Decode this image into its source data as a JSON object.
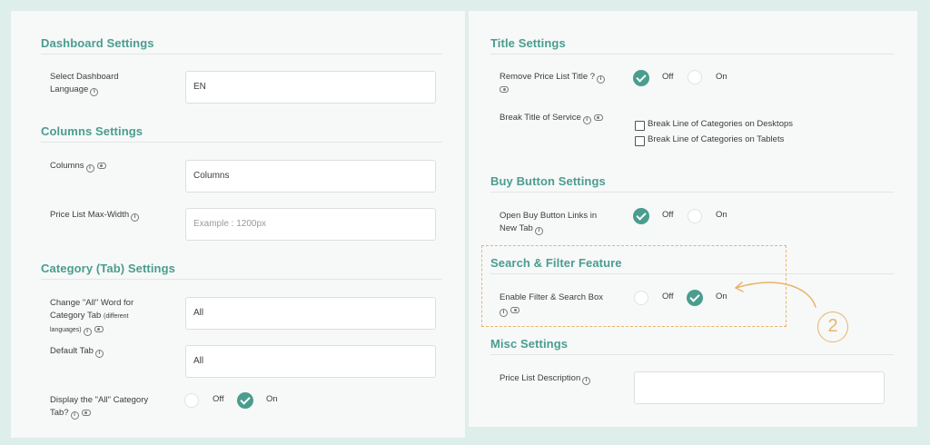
{
  "left": {
    "dashboard": {
      "title": "Dashboard Settings",
      "language_label_1": "Select Dashboard",
      "language_label_2": "Language",
      "language_value": "EN"
    },
    "columns": {
      "title": "Columns Settings",
      "columns_label": "Columns",
      "columns_value": "Columns",
      "maxwidth_label": "Price List Max-Width",
      "maxwidth_placeholder": "Example : 1200px"
    },
    "category": {
      "title": "Category (Tab) Settings",
      "all_word_label_1": "Change \"All\" Word for",
      "all_word_label_2": "Category Tab",
      "all_word_label_small": "(different",
      "all_word_label_3": "languages)",
      "all_word_value": "All",
      "default_tab_label": "Default Tab",
      "default_tab_value": "All",
      "display_all_label_1": "Display the \"All\" Category",
      "display_all_label_2": "Tab?",
      "display_all_off": "Off",
      "display_all_on": "On"
    }
  },
  "right": {
    "title_settings": {
      "title": "Title Settings",
      "remove_title_label": "Remove Price List Title ?",
      "remove_title_off": "Off",
      "remove_title_on": "On",
      "break_title_label": "Break Title of Service",
      "break_desktops": "Break Line of Categories on Desktops",
      "break_tablets": "Break Line of Categories on Tablets"
    },
    "buy_button": {
      "title": "Buy Button Settings",
      "open_links_label_1": "Open Buy Button Links in",
      "open_links_label_2": "New Tab",
      "open_links_off": "Off",
      "open_links_on": "On"
    },
    "search_filter": {
      "title": "Search & Filter Feature",
      "enable_label": "Enable Filter & Search Box",
      "enable_off": "Off",
      "enable_on": "On"
    },
    "misc": {
      "title": "Misc Settings",
      "description_label": "Price List Description",
      "description_value": ""
    }
  },
  "annotation": {
    "step_number": "2"
  },
  "colors": {
    "accent": "#4a9d8f",
    "highlight": "#e9b469",
    "background": "#deeeea"
  }
}
